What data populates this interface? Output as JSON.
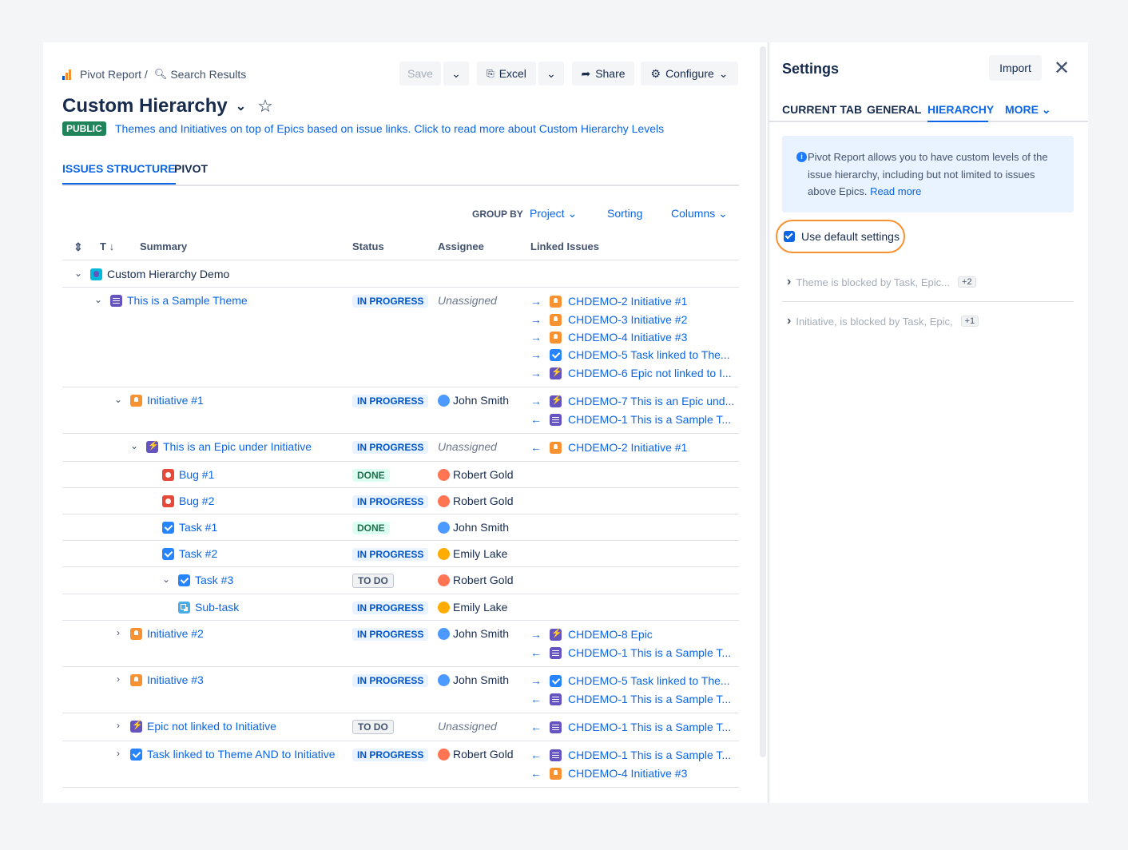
{
  "header": {
    "breadcrumb_root": "Pivot Report /",
    "breadcrumb_current": "Search Results",
    "save_label": "Save",
    "excel_label": "Excel",
    "share_label": "Share",
    "configure_label": "Configure",
    "title": "Custom Hierarchy",
    "visibility_badge": "PUBLIC",
    "description": "Themes and Initiatives on top of Epics based on issue links. Click to read more about Custom Hierarchy Levels"
  },
  "tabs": {
    "structure": "ISSUES STRUCTURE",
    "pivot": "PIVOT"
  },
  "controls": {
    "group_by_label": "GROUP BY",
    "group_by_value": "Project",
    "sorting": "Sorting",
    "columns": "Columns"
  },
  "columns": {
    "type": "T",
    "summary": "Summary",
    "status": "Status",
    "assignee": "Assignee",
    "linked": "Linked Issues"
  },
  "rows": [
    {
      "summary": "Custom Hierarchy Demo"
    },
    {
      "summary": "This is a Sample Theme",
      "status": "IN PROGRESS",
      "assignee": "Unassigned",
      "links": [
        "CHDEMO-2 Initiative #1",
        "CHDEMO-3 Initiative #2",
        "CHDEMO-4 Initiative #3",
        "CHDEMO-5 Task linked to The...",
        "CHDEMO-6 Epic not linked to I..."
      ]
    },
    {
      "summary": "Initiative #1",
      "status": "IN PROGRESS",
      "assignee": "John Smith",
      "links": [
        "CHDEMO-7 This is an Epic und...",
        "CHDEMO-1 This is a Sample T..."
      ]
    },
    {
      "summary": "This is an Epic under Initiative",
      "status": "IN PROGRESS",
      "assignee": "Unassigned",
      "links": [
        "CHDEMO-2 Initiative #1"
      ]
    },
    {
      "summary": "Bug #1",
      "status": "DONE",
      "assignee": "Robert Gold"
    },
    {
      "summary": "Bug #2",
      "status": "IN PROGRESS",
      "assignee": "Robert Gold"
    },
    {
      "summary": "Task #1",
      "status": "DONE",
      "assignee": "John Smith"
    },
    {
      "summary": "Task #2",
      "status": "IN PROGRESS",
      "assignee": "Emily Lake"
    },
    {
      "summary": "Task #3",
      "status": "TO DO",
      "assignee": "Robert Gold"
    },
    {
      "summary": "Sub-task",
      "status": "IN PROGRESS",
      "assignee": "Emily Lake"
    },
    {
      "summary": "Initiative #2",
      "status": "IN PROGRESS",
      "assignee": "John Smith",
      "links": [
        "CHDEMO-8 Epic",
        "CHDEMO-1 This is a Sample T..."
      ]
    },
    {
      "summary": "Initiative #3",
      "status": "IN PROGRESS",
      "assignee": "John Smith",
      "links": [
        "CHDEMO-5 Task linked to The...",
        "CHDEMO-1 This is a Sample T..."
      ]
    },
    {
      "summary": "Epic not linked to Initiative",
      "status": "TO DO",
      "assignee": "Unassigned",
      "links": [
        "CHDEMO-1 This is a Sample T..."
      ]
    },
    {
      "summary": "Task linked to Theme AND to Initiative",
      "status": "IN PROGRESS",
      "assignee": "Robert Gold",
      "links": [
        "CHDEMO-1 This is a Sample T...",
        "CHDEMO-4 Initiative #3"
      ]
    }
  ],
  "settings": {
    "title": "Settings",
    "import_label": "Import",
    "tabs": [
      "CURRENT TAB",
      "GENERAL",
      "HIERARCHY",
      "MORE"
    ],
    "info_text": "Pivot Report allows you to have custom levels of the issue hierarchy, including but not limited to issues above Epics.",
    "info_link": "Read more",
    "default_checkbox": "Use default settings",
    "levels": [
      {
        "label": "Theme is blocked by Task, Epic...",
        "count": "+2"
      },
      {
        "label": "Initiative, is blocked by Task, Epic,",
        "count": "+1"
      }
    ]
  },
  "colors": {
    "accent": "#0c66e4",
    "highlight": "#f79232",
    "public": "#1f845a"
  }
}
